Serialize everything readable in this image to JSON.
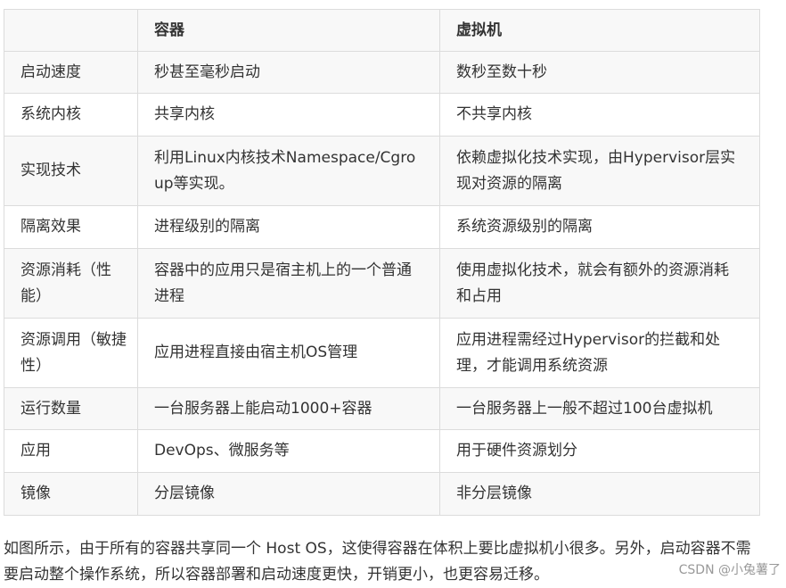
{
  "table": {
    "headers": [
      "",
      "容器",
      "虚拟机"
    ],
    "rows": [
      [
        "启动速度",
        "秒甚至毫秒启动",
        "数秒至数十秒"
      ],
      [
        "系统内核",
        "共享内核",
        "不共享内核"
      ],
      [
        "实现技术",
        "利用Linux内核技术Namespace/Cgroup等实现。",
        "依赖虚拟化技术实现，由Hypervisor层实现对资源的隔离"
      ],
      [
        "隔离效果",
        "进程级别的隔离",
        "系统资源级别的隔离"
      ],
      [
        "资源消耗（性能）",
        "容器中的应用只是宿主机上的一个普通进程",
        "使用虚拟化技术，就会有额外的资源消耗和占用"
      ],
      [
        "资源调用（敏捷性）",
        "应用进程直接由宿主机OS管理",
        "应用进程需经过Hypervisor的拦截和处理，才能调用系统资源"
      ],
      [
        "运行数量",
        "一台服务器上能启动1000+容器",
        "一台服务器上一般不超过100台虚拟机"
      ],
      [
        "应用",
        "DevOps、微服务等",
        "用于硬件资源划分"
      ],
      [
        "镜像",
        "分层镜像",
        "非分层镜像"
      ]
    ]
  },
  "summary": "如图所示，由于所有的容器共享同一个 Host OS，这使得容器在体积上要比虚拟机小很多。另外，启动容器不需要启动整个操作系统，所以容器部署和启动速度更快，开销更小，也更容易迁移。",
  "watermark": "CSDN @小兔薯了"
}
